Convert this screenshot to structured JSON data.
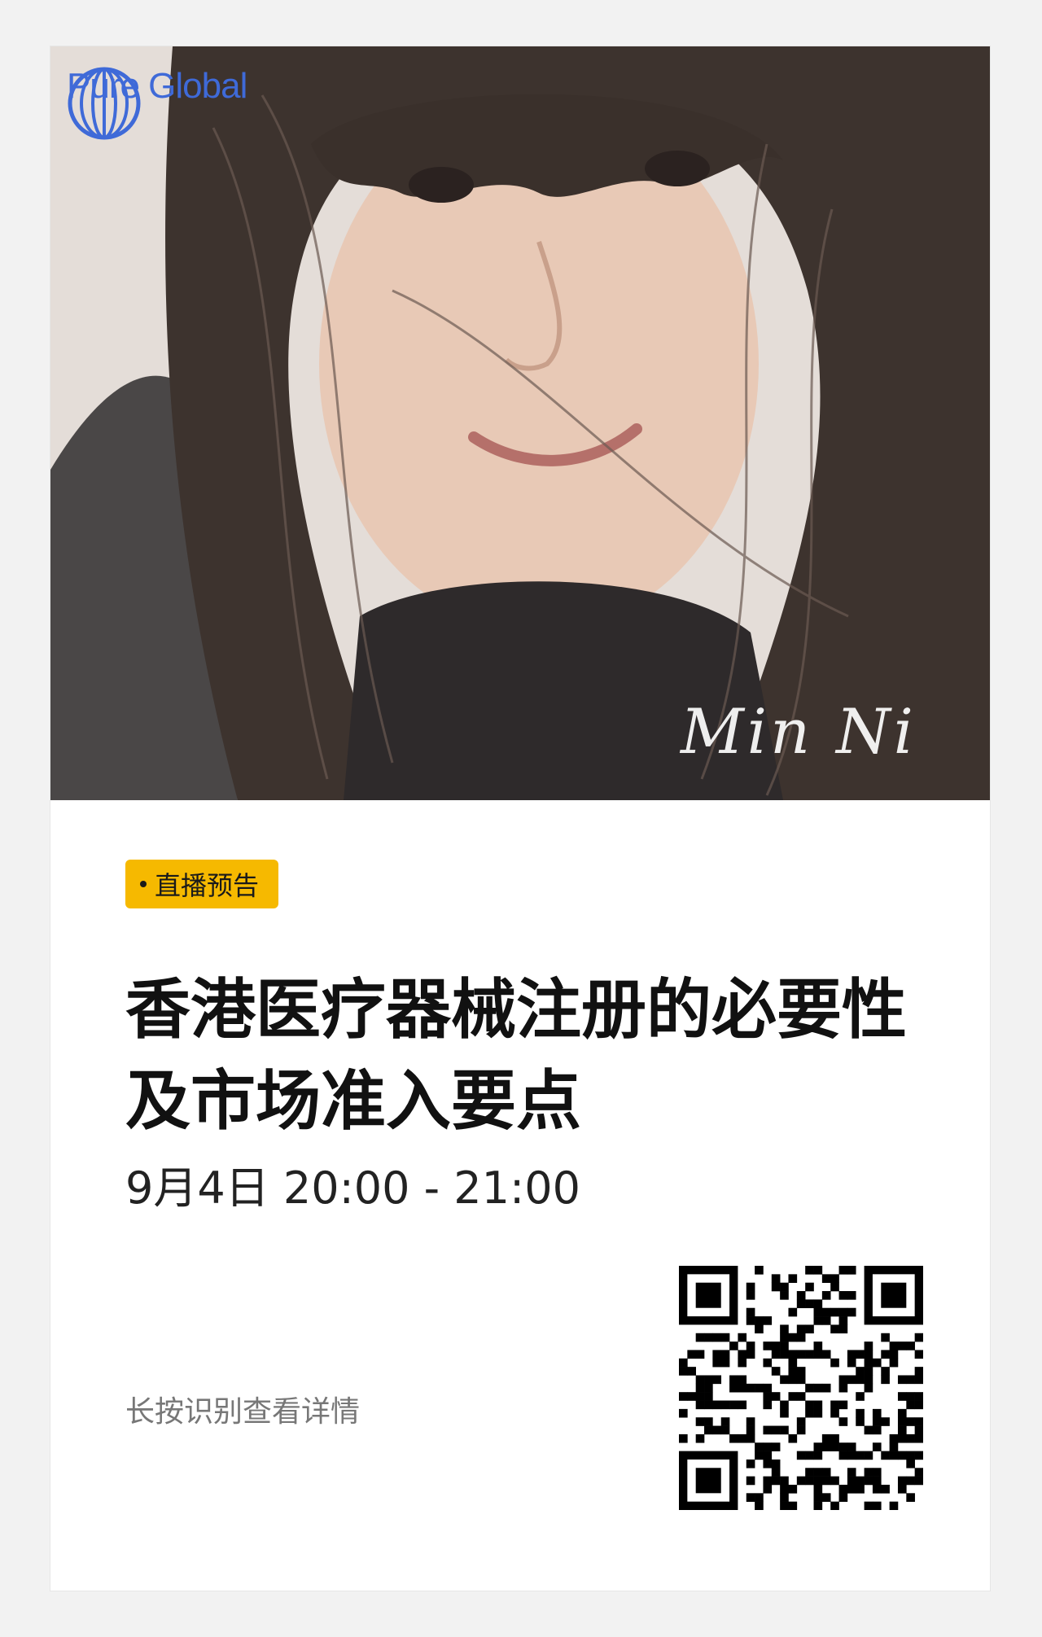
{
  "brand": {
    "name": "Pure Global",
    "color": "#3f6ad8"
  },
  "photo": {
    "signature": "Min Ni"
  },
  "badge": {
    "label": "直播预告",
    "color": "#f6b900"
  },
  "event": {
    "title": "香港医疗器械注册的必要性及市场准入要点",
    "time": "9月4日 20:00 - 21:00"
  },
  "footer": {
    "hint": "长按识别查看详情",
    "qr_icon": "qr-code-icon"
  }
}
